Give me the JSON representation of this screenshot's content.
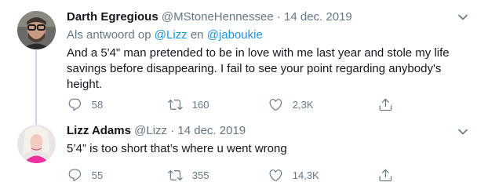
{
  "tweets": [
    {
      "name": "Darth Egregious",
      "handle": "@MStoneHennessee",
      "dot": "·",
      "date": "14 dec. 2019",
      "reply_prefix": "Als antwoord op",
      "reply_user1": "@Lizz",
      "reply_joiner": "en",
      "reply_user2": "@jaboukie",
      "text": "And a 5'4\" man pretended to be in love with me last year and stole my life savings before disappearing. I fail to see your point regarding anybody's height.",
      "replies": "58",
      "retweets": "160",
      "likes": "2,3K"
    },
    {
      "name": "Lizz Adams",
      "handle": "@Lizz",
      "dot": "·",
      "date": "14 dec. 2019",
      "text": "5’4” is too short that’s where u went wrong",
      "replies": "55",
      "retweets": "355",
      "likes": "14,3K"
    }
  ],
  "colors": {
    "accent": "#1b95e0",
    "secondary_text": "#657786",
    "thread_line": "#ccd6dd"
  },
  "icons": {
    "reply": "reply-icon",
    "retweet": "retweet-icon",
    "like": "heart-icon",
    "share": "share-icon",
    "more": "chevron-down-icon"
  }
}
